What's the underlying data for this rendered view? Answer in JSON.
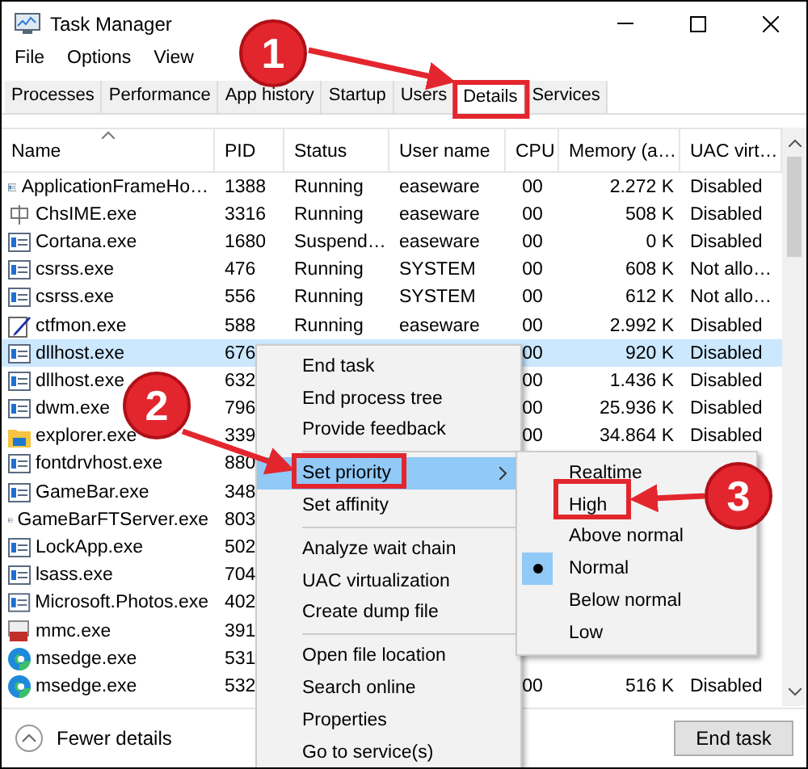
{
  "window": {
    "title": "Task Manager"
  },
  "menu": [
    "File",
    "Options",
    "View"
  ],
  "tabs": [
    {
      "label": "Processes",
      "selected": false
    },
    {
      "label": "Performance",
      "selected": false
    },
    {
      "label": "App history",
      "selected": false
    },
    {
      "label": "Startup",
      "selected": false
    },
    {
      "label": "Users",
      "selected": false
    },
    {
      "label": "Details",
      "selected": true
    },
    {
      "label": "Services",
      "selected": false
    }
  ],
  "table": {
    "columns": [
      "Name",
      "PID",
      "Status",
      "User name",
      "CPU",
      "Memory (a…",
      "UAC virt…"
    ],
    "rows": [
      {
        "kind": "app",
        "name": "ApplicationFrameHo…",
        "pid": "1388",
        "status": "Running",
        "user": "easeware",
        "cpu": "00",
        "memory": "2.272 K",
        "uac": "Disabled",
        "selected": false
      },
      {
        "kind": "ime",
        "name": "ChsIME.exe",
        "pid": "3316",
        "status": "Running",
        "user": "easeware",
        "cpu": "00",
        "memory": "508 K",
        "uac": "Disabled",
        "selected": false
      },
      {
        "kind": "app",
        "name": "Cortana.exe",
        "pid": "1680",
        "status": "Suspend…",
        "user": "easeware",
        "cpu": "00",
        "memory": "0 K",
        "uac": "Disabled",
        "selected": false
      },
      {
        "kind": "app",
        "name": "csrss.exe",
        "pid": "476",
        "status": "Running",
        "user": "SYSTEM",
        "cpu": "00",
        "memory": "608 K",
        "uac": "Not allo…",
        "selected": false
      },
      {
        "kind": "app",
        "name": "csrss.exe",
        "pid": "556",
        "status": "Running",
        "user": "SYSTEM",
        "cpu": "00",
        "memory": "612 K",
        "uac": "Not allo…",
        "selected": false
      },
      {
        "kind": "pen",
        "name": "ctfmon.exe",
        "pid": "588",
        "status": "Running",
        "user": "easeware",
        "cpu": "00",
        "memory": "2.992 K",
        "uac": "Disabled",
        "selected": false
      },
      {
        "kind": "app",
        "name": "dllhost.exe",
        "pid": "676",
        "cpu": "00",
        "memory": "920 K",
        "uac": "Disabled",
        "selected": true
      },
      {
        "kind": "app",
        "name": "dllhost.exe",
        "pid": "632",
        "cpu": "00",
        "memory": "1.436 K",
        "uac": "Disabled",
        "selected": false
      },
      {
        "kind": "app",
        "name": "dwm.exe",
        "pid": "796",
        "cpu": "00",
        "memory": "25.936 K",
        "uac": "Disabled",
        "selected": false
      },
      {
        "kind": "folder",
        "name": "explorer.exe",
        "pid": "339",
        "cpu": "00",
        "memory": "34.864 K",
        "uac": "Disabled",
        "selected": false
      },
      {
        "kind": "app",
        "name": "fontdrvhost.exe",
        "pid": "880",
        "selected": false
      },
      {
        "kind": "app",
        "name": "GameBar.exe",
        "pid": "348",
        "selected": false
      },
      {
        "kind": "app",
        "name": "GameBarFTServer.exe",
        "pid": "803",
        "selected": false
      },
      {
        "kind": "app",
        "name": "LockApp.exe",
        "pid": "502",
        "selected": false
      },
      {
        "kind": "app",
        "name": "lsass.exe",
        "pid": "704",
        "selected": false
      },
      {
        "kind": "app",
        "name": "Microsoft.Photos.exe",
        "pid": "402",
        "selected": false
      },
      {
        "kind": "mmc",
        "name": "mmc.exe",
        "pid": "391",
        "selected": false
      },
      {
        "kind": "edge",
        "name": "msedge.exe",
        "pid": "531",
        "selected": false
      },
      {
        "kind": "edge",
        "name": "msedge.exe",
        "pid": "532",
        "cpu": "00",
        "memory": "516 K",
        "uac": "Disabled",
        "selected": false
      }
    ]
  },
  "context_menu": {
    "groups": [
      [
        {
          "label": "End task",
          "highlighted": false,
          "submenu": false
        },
        {
          "label": "End process tree",
          "highlighted": false,
          "submenu": false
        },
        {
          "label": "Provide feedback",
          "highlighted": false,
          "submenu": false
        }
      ],
      [
        {
          "label": "Set priority",
          "highlighted": true,
          "submenu": true
        },
        {
          "label": "Set affinity",
          "highlighted": false,
          "submenu": false
        }
      ],
      [
        {
          "label": "Analyze wait chain",
          "highlighted": false,
          "submenu": false
        },
        {
          "label": "UAC virtualization",
          "highlighted": false,
          "submenu": false
        },
        {
          "label": "Create dump file",
          "highlighted": false,
          "submenu": false
        }
      ],
      [
        {
          "label": "Open file location",
          "highlighted": false,
          "submenu": false
        },
        {
          "label": "Search online",
          "highlighted": false,
          "submenu": false
        },
        {
          "label": "Properties",
          "highlighted": false,
          "submenu": false
        },
        {
          "label": "Go to service(s)",
          "highlighted": false,
          "submenu": false
        }
      ]
    ]
  },
  "priority_menu": {
    "items": [
      {
        "label": "Realtime",
        "checked": false
      },
      {
        "label": "High",
        "checked": false
      },
      {
        "label": "Above normal",
        "checked": false
      },
      {
        "label": "Normal",
        "checked": true
      },
      {
        "label": "Below normal",
        "checked": false
      },
      {
        "label": "Low",
        "checked": false
      }
    ]
  },
  "footer": {
    "toggle": "Fewer details",
    "button": "End task"
  },
  "annotations": [
    {
      "number": "1"
    },
    {
      "number": "2"
    },
    {
      "number": "3"
    }
  ]
}
